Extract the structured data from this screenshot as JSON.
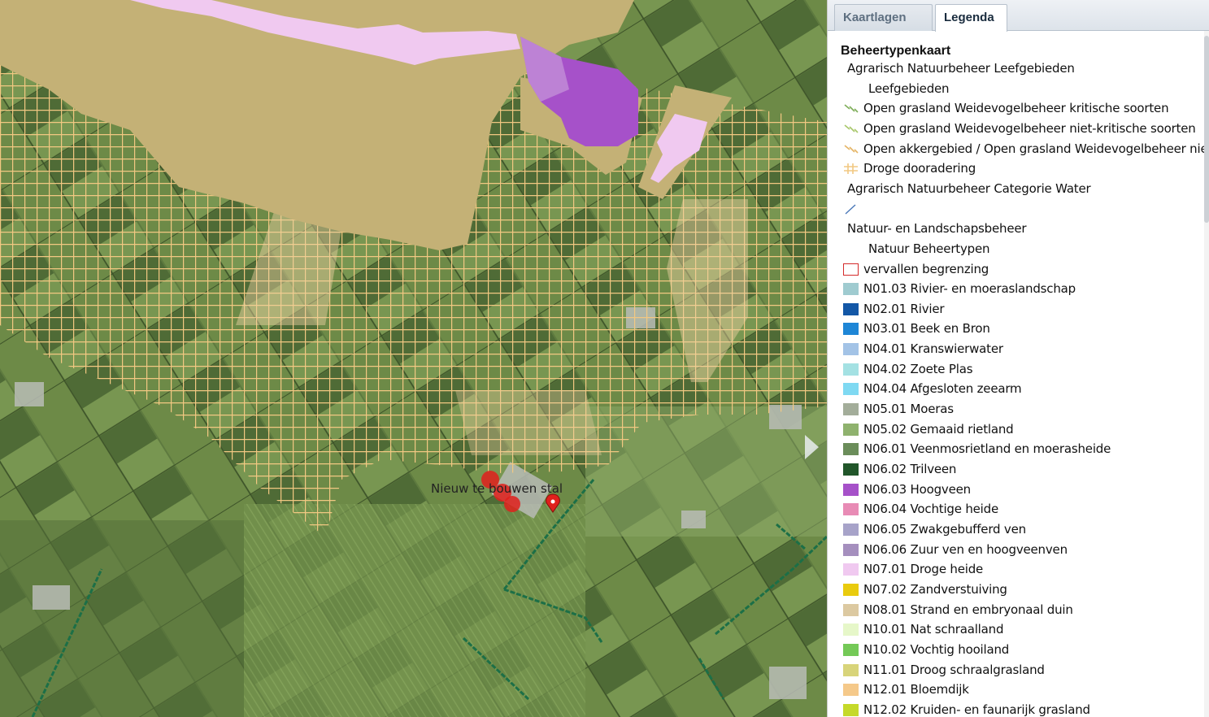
{
  "tabs": [
    {
      "label": "Kaartlagen",
      "active": false
    },
    {
      "label": "Legenda",
      "active": true
    }
  ],
  "map": {
    "marker_label": "Nieuw te bouwen stal"
  },
  "legend": {
    "title": "Beheertypenkaart",
    "rows": [
      {
        "text": "Agrarisch Natuurbeheer Leefgebieden",
        "kind": "group"
      },
      {
        "text": "Leefgebieden",
        "kind": "subgroup"
      },
      {
        "text": "Open grasland Weidevogelbeheer kritische soorten",
        "kind": "item",
        "swatch": "hatch",
        "color": "#7fae5a"
      },
      {
        "text": "Open grasland Weidevogelbeheer niet-kritische soorten",
        "kind": "item",
        "swatch": "hatch",
        "color": "#a8c76b"
      },
      {
        "text": "Open akkergebied / Open grasland Weidevogelbeheer niet",
        "kind": "item",
        "swatch": "hatch",
        "color": "#e5b566"
      },
      {
        "text": "Droge dooradering",
        "kind": "item",
        "swatch": "grid",
        "color": "#f2c882"
      },
      {
        "text": "Agrarisch Natuurbeheer Categorie Water",
        "kind": "group"
      },
      {
        "text": "",
        "kind": "item",
        "swatch": "line",
        "color": "#4a78b8"
      },
      {
        "text": "Natuur- en Landschapsbeheer",
        "kind": "group"
      },
      {
        "text": "Natuur Beheertypen",
        "kind": "subgroup"
      },
      {
        "text": "vervallen begrenzing",
        "kind": "item",
        "swatch": "outline",
        "color": "#d42a2a"
      },
      {
        "text": "N01.03 Rivier- en moeraslandschap",
        "kind": "item",
        "swatch": "fill",
        "color": "#9fcbd0"
      },
      {
        "text": "N02.01 Rivier",
        "kind": "item",
        "swatch": "fill",
        "color": "#1357a6"
      },
      {
        "text": "N03.01 Beek en Bron",
        "kind": "item",
        "swatch": "fill",
        "color": "#1e86d6"
      },
      {
        "text": "N04.01 Kranswierwater",
        "kind": "item",
        "swatch": "fill",
        "color": "#a3c3e6"
      },
      {
        "text": "N04.02 Zoete Plas",
        "kind": "item",
        "swatch": "fill",
        "color": "#a4e1e3"
      },
      {
        "text": "N04.04 Afgesloten zeearm",
        "kind": "item",
        "swatch": "fill",
        "color": "#7fd9f2"
      },
      {
        "text": "N05.01 Moeras",
        "kind": "item",
        "swatch": "fill",
        "color": "#a3ad9a"
      },
      {
        "text": "N05.02 Gemaaid rietland",
        "kind": "item",
        "swatch": "fill",
        "color": "#8fb26e"
      },
      {
        "text": "N06.01 Veenmosrietland en moerasheide",
        "kind": "item",
        "swatch": "fill",
        "color": "#6b8d5a"
      },
      {
        "text": "N06.02 Trilveen",
        "kind": "item",
        "swatch": "fill",
        "color": "#21562a"
      },
      {
        "text": "N06.03 Hoogveen",
        "kind": "item",
        "swatch": "fill",
        "color": "#a651c9"
      },
      {
        "text": "N06.04 Vochtige heide",
        "kind": "item",
        "swatch": "fill",
        "color": "#e88bb5"
      },
      {
        "text": "N06.05 Zwakgebufferd ven",
        "kind": "item",
        "swatch": "fill",
        "color": "#a7a3c9"
      },
      {
        "text": "N06.06 Zuur ven en hoogveenven",
        "kind": "item",
        "swatch": "fill",
        "color": "#a58fbe"
      },
      {
        "text": "N07.01 Droge heide",
        "kind": "item",
        "swatch": "fill",
        "color": "#f0c9f0"
      },
      {
        "text": "N07.02 Zandverstuiving",
        "kind": "item",
        "swatch": "fill",
        "color": "#e9cb0e"
      },
      {
        "text": "N08.01 Strand en embryonaal duin",
        "kind": "item",
        "swatch": "fill",
        "color": "#dcc9a1"
      },
      {
        "text": "N10.01 Nat schraalland",
        "kind": "item",
        "swatch": "fill",
        "color": "#e6f7c9"
      },
      {
        "text": "N10.02 Vochtig hooiland",
        "kind": "item",
        "swatch": "fill",
        "color": "#74c957"
      },
      {
        "text": "N11.01 Droog schraalgrasland",
        "kind": "item",
        "swatch": "fill",
        "color": "#d8d47a"
      },
      {
        "text": "N12.01 Bloemdijk",
        "kind": "item",
        "swatch": "fill",
        "color": "#f5c98a"
      },
      {
        "text": "N12.02 Kruiden- en faunarijk grasland",
        "kind": "item",
        "swatch": "fill",
        "color": "#c5d92a"
      }
    ]
  },
  "colors": {
    "accent": "#c4b176",
    "hoogveen": "#a651c9",
    "droge_heide": "#f0c9f0",
    "grid": "#f2c882",
    "border_green": "#1c6f47",
    "marker": "#e0201c"
  }
}
